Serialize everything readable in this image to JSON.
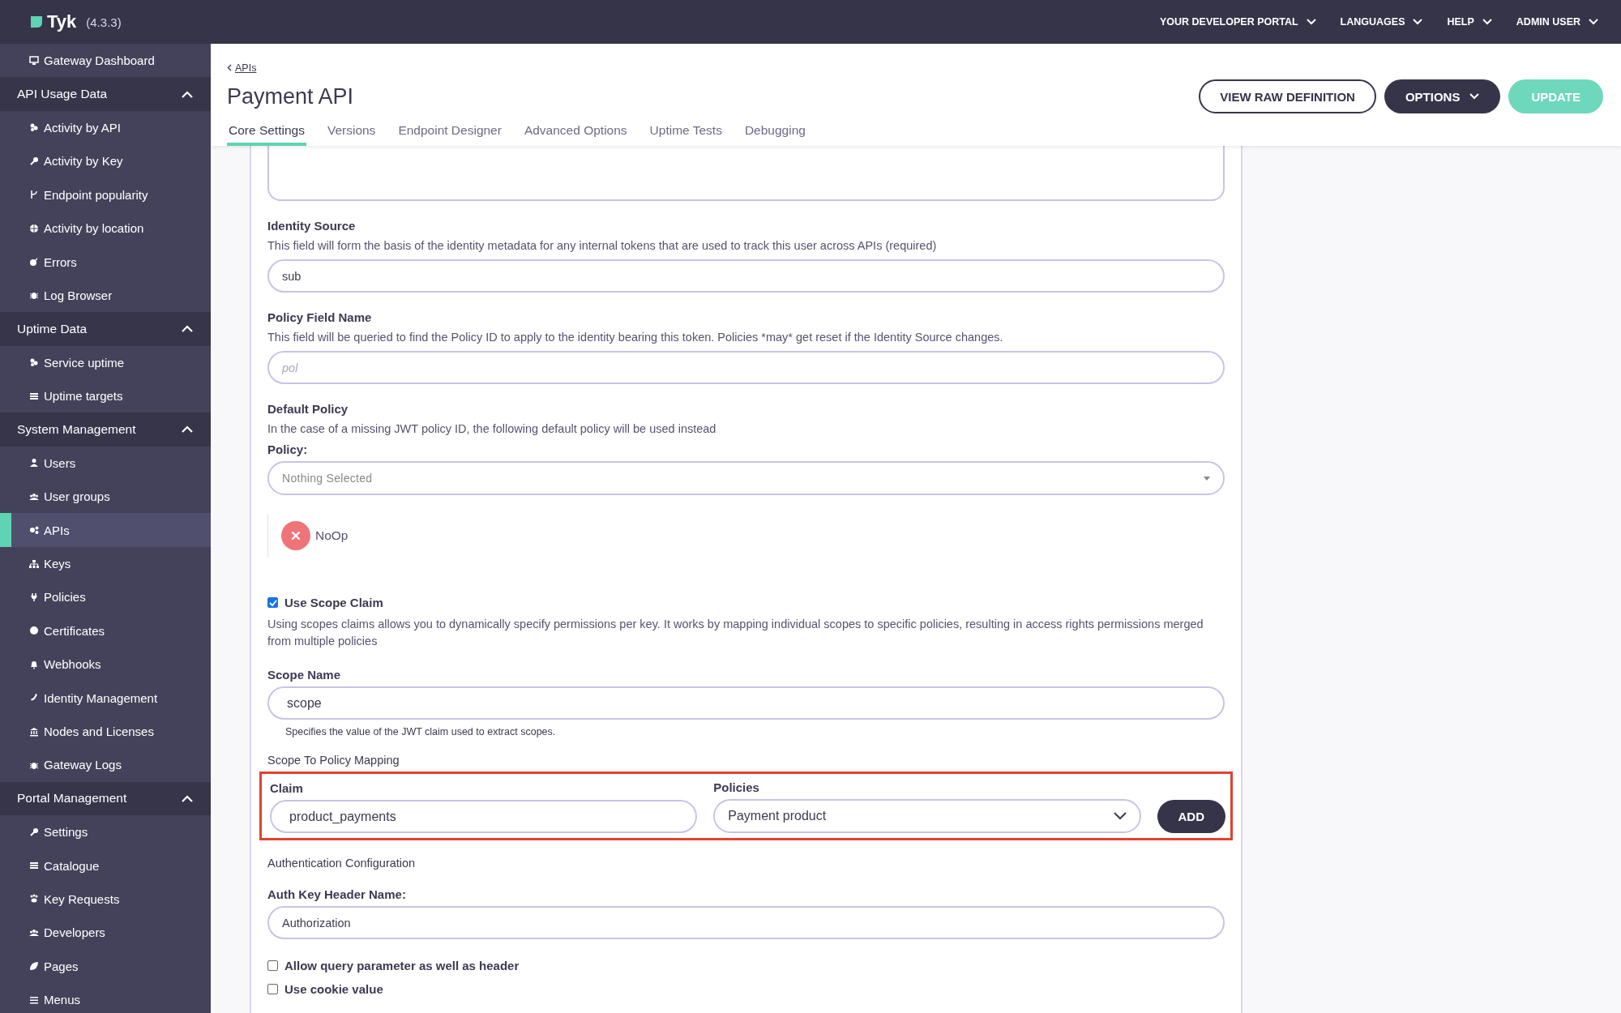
{
  "top_bar": {
    "logo": "Tyk",
    "version": "(4.3.3)",
    "menus": [
      {
        "label": "YOUR DEVELOPER PORTAL"
      },
      {
        "label": "LANGUAGES"
      },
      {
        "label": "HELP"
      },
      {
        "label": "ADMIN USER"
      }
    ]
  },
  "sidebar": {
    "top_items": [
      {
        "label": "Gateway Dashboard",
        "selected": false
      }
    ],
    "groups": [
      {
        "title": "API Usage Data",
        "expanded": true,
        "items": [
          {
            "label": "Activity by API",
            "selected": false
          },
          {
            "label": "Activity by Key",
            "selected": false
          },
          {
            "label": "Endpoint popularity",
            "selected": false
          },
          {
            "label": "Activity by location",
            "selected": false
          },
          {
            "label": "Errors",
            "selected": false
          },
          {
            "label": "Log Browser",
            "selected": false
          }
        ]
      },
      {
        "title": "Uptime Data",
        "expanded": true,
        "items": [
          {
            "label": "Service uptime",
            "selected": false
          },
          {
            "label": "Uptime targets",
            "selected": false
          }
        ]
      },
      {
        "title": "System Management",
        "expanded": true,
        "items": [
          {
            "label": "Users",
            "selected": false
          },
          {
            "label": "User groups",
            "selected": false
          },
          {
            "label": "APIs",
            "selected": true
          },
          {
            "label": "Keys",
            "selected": false
          },
          {
            "label": "Policies",
            "selected": false
          },
          {
            "label": "Certificates",
            "selected": false
          },
          {
            "label": "Webhooks",
            "selected": false
          },
          {
            "label": "Identity Management",
            "selected": false
          },
          {
            "label": "Nodes and Licenses",
            "selected": false
          },
          {
            "label": "Gateway Logs",
            "selected": false
          }
        ]
      },
      {
        "title": "Portal Management",
        "expanded": true,
        "items": [
          {
            "label": "Settings",
            "selected": false
          },
          {
            "label": "Catalogue",
            "selected": false
          },
          {
            "label": "Key Requests",
            "selected": false
          },
          {
            "label": "Developers",
            "selected": false
          },
          {
            "label": "Pages",
            "selected": false
          },
          {
            "label": "Menus",
            "selected": false
          }
        ]
      }
    ]
  },
  "header": {
    "breadcrumb": "APIs",
    "title": "Payment API",
    "buttons": [
      {
        "label": "VIEW RAW DEFINITION",
        "kind": "outline"
      },
      {
        "label": "OPTIONS",
        "kind": "dropdown"
      },
      {
        "label": "UPDATE",
        "kind": "primary"
      }
    ],
    "tabs": [
      {
        "label": "Core Settings",
        "selected": true
      },
      {
        "label": "Versions",
        "selected": false
      },
      {
        "label": "Endpoint Designer",
        "selected": false
      },
      {
        "label": "Advanced Options",
        "selected": false
      },
      {
        "label": "Uptime Tests",
        "selected": false
      },
      {
        "label": "Debugging",
        "selected": false
      }
    ]
  },
  "form": {
    "identity_source": {
      "label": "Identity Source",
      "description": "This field will form the basis of the identity metadata for any internal tokens that are used to track this user across APIs (required)",
      "value": "sub"
    },
    "policy_field_name": {
      "label": "Policy Field Name",
      "description": "This field will be queried to find the Policy ID to apply to the identity bearing this token. Policies *may* get reset if the Identity Source changes.",
      "placeholder": "pol"
    },
    "default_policy": {
      "label": "Default Policy",
      "description": "In the case of a missing JWT policy ID, the following default policy will be used instead",
      "select_label": "Policy:",
      "select_placeholder": "Nothing Selected",
      "chosen": [
        {
          "name": "NoOp"
        }
      ]
    },
    "use_scope_claim": {
      "label": "Use Scope Claim",
      "checked": true,
      "description": "Using scopes claims allows you to dynamically specify permissions per key. It works by mapping individual scopes to specific policies, resulting in access rights permissions merged from multiple policies"
    },
    "scope_name": {
      "label": "Scope Name",
      "value": "scope",
      "help": "Specifies the value of the JWT claim used to extract scopes."
    },
    "scope_mapping": {
      "title": "Scope To Policy Mapping",
      "highlighted": true,
      "claim_label": "Claim",
      "claim_value": "product_payments",
      "policies_label": "Policies",
      "policies_value": "Payment product",
      "add_button": "ADD"
    },
    "auth_config": {
      "title": "Authentication Configuration",
      "header_label": "Auth Key Header Name:",
      "header_value": "Authorization"
    },
    "options": [
      {
        "label": "Allow query parameter as well as header",
        "checked": false
      },
      {
        "label": "Use cookie value",
        "checked": false
      }
    ]
  }
}
